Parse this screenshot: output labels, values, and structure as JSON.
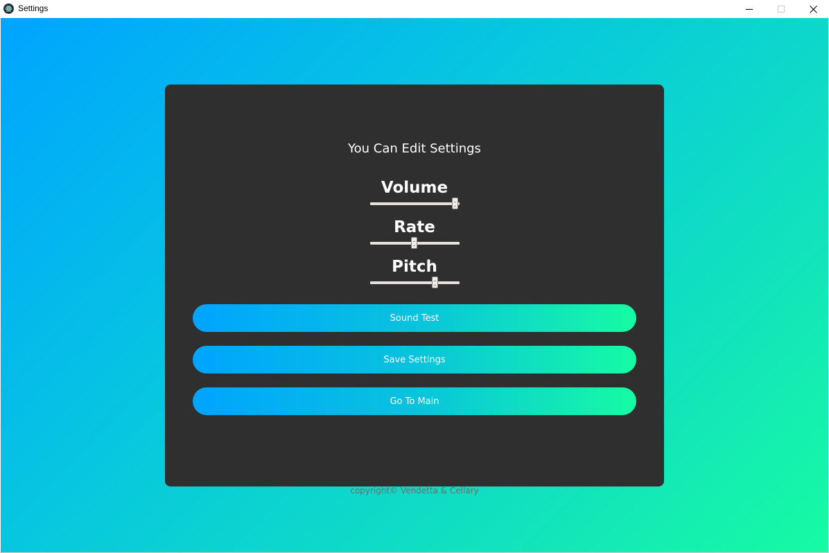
{
  "window": {
    "title": "Settings",
    "app_icon": "electron-icon"
  },
  "titlebar": {
    "minimize_icon": "minimize-icon",
    "maximize_icon": "maximize-icon",
    "close_icon": "close-icon"
  },
  "card": {
    "heading": "You Can Edit Settings",
    "sliders": [
      {
        "label": "Volume",
        "value_fraction": 0.96
      },
      {
        "label": "Rate",
        "value_fraction": 0.5
      },
      {
        "label": "Pitch",
        "value_fraction": 0.73
      }
    ],
    "buttons": [
      {
        "label": "Sound Test"
      },
      {
        "label": "Save Settings"
      },
      {
        "label": "Go To Main"
      }
    ]
  },
  "footer": {
    "copyright": "copyright© Vendetta & Cellary"
  },
  "colors": {
    "card_bg": "#2f2f2f",
    "gradient_start": "#00a4ff",
    "gradient_end": "#16fba3",
    "text_white": "#ffffff",
    "copyright_gray": "#6b6b6b"
  }
}
